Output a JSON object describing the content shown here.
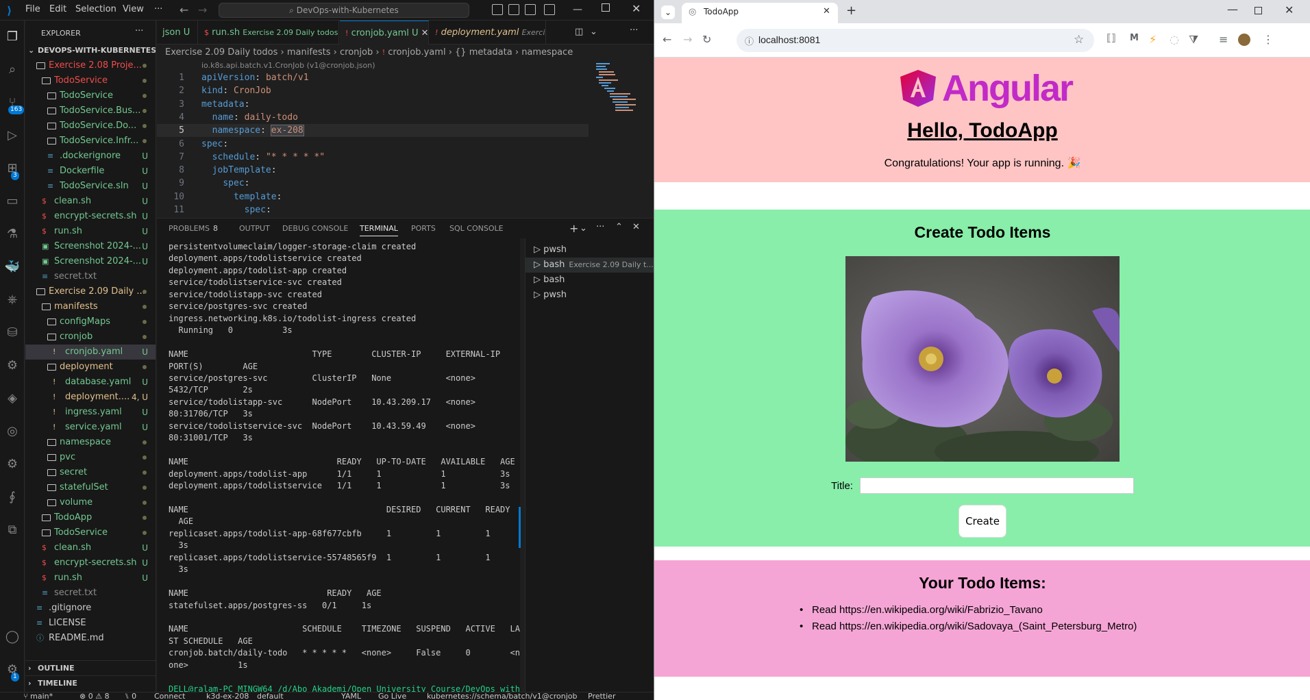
{
  "vscode": {
    "menu": [
      "File",
      "Edit",
      "Selection",
      "View",
      "···"
    ],
    "command_center": "DevOps-with-Kubernetes",
    "activity_badges": {
      "source_control": "163",
      "extensions": "3",
      "accounts": "1"
    },
    "explorer": {
      "title": "EXPLORER",
      "root": "DEVOPS-WITH-KUBERNETES",
      "tree": [
        {
          "label": "Exercise 2.08 Proje...",
          "color": "red",
          "indent": 1,
          "type": "folder",
          "badge": "dot"
        },
        {
          "label": "TodoService",
          "color": "red",
          "indent": 2,
          "type": "folder",
          "badge": "dot"
        },
        {
          "label": "TodoService",
          "color": "green",
          "indent": 3,
          "type": "folder",
          "badge": "dot"
        },
        {
          "label": "TodoService.Bus...",
          "color": "green",
          "indent": 3,
          "type": "folder",
          "badge": "dot"
        },
        {
          "label": "TodoService.Do...",
          "color": "green",
          "indent": 3,
          "type": "folder",
          "badge": "dot"
        },
        {
          "label": "TodoService.Infr...",
          "color": "green",
          "indent": 3,
          "type": "folder",
          "badge": "dot"
        },
        {
          "label": ".dockerignore",
          "color": "green",
          "indent": 3,
          "type": "file",
          "badge": "U"
        },
        {
          "label": "Dockerfile",
          "color": "green",
          "indent": 3,
          "type": "file",
          "badge": "U"
        },
        {
          "label": "TodoService.sln",
          "color": "green",
          "indent": 3,
          "type": "file",
          "badge": "U"
        },
        {
          "label": "clean.sh",
          "color": "green",
          "indent": 2,
          "type": "file",
          "badge": "U"
        },
        {
          "label": "encrypt-secrets.sh",
          "color": "green",
          "indent": 2,
          "type": "file",
          "badge": "U"
        },
        {
          "label": "run.sh",
          "color": "green",
          "indent": 2,
          "type": "file",
          "badge": "U"
        },
        {
          "label": "Screenshot 2024-...",
          "color": "green",
          "indent": 2,
          "type": "file",
          "badge": "U"
        },
        {
          "label": "Screenshot 2024-...",
          "color": "green",
          "indent": 2,
          "type": "file",
          "badge": "U"
        },
        {
          "label": "secret.txt",
          "color": "gray",
          "indent": 2,
          "type": "file",
          "badge": ""
        },
        {
          "label": "Exercise 2.09 Daily ...",
          "color": "yellow",
          "indent": 1,
          "type": "folder",
          "badge": "dot"
        },
        {
          "label": "manifests",
          "color": "yellow",
          "indent": 2,
          "type": "folder",
          "badge": "dot"
        },
        {
          "label": "configMaps",
          "color": "green",
          "indent": 3,
          "type": "folder",
          "badge": "dot"
        },
        {
          "label": "cronjob",
          "color": "green",
          "indent": 3,
          "type": "folder",
          "badge": "dot"
        },
        {
          "label": "cronjob.yaml",
          "color": "green",
          "indent": 4,
          "type": "file",
          "badge": "U"
        },
        {
          "label": "deployment",
          "color": "yellow",
          "indent": 3,
          "type": "folder",
          "badge": "dot"
        },
        {
          "label": "database.yaml",
          "color": "green",
          "indent": 4,
          "type": "file",
          "badge": "U"
        },
        {
          "label": "deployment....",
          "color": "yellow",
          "indent": 4,
          "type": "file",
          "badge": "4, U"
        },
        {
          "label": "ingress.yaml",
          "color": "green",
          "indent": 4,
          "type": "file",
          "badge": "U"
        },
        {
          "label": "service.yaml",
          "color": "green",
          "indent": 4,
          "type": "file",
          "badge": "U"
        },
        {
          "label": "namespace",
          "color": "green",
          "indent": 3,
          "type": "folder",
          "badge": "dot"
        },
        {
          "label": "pvc",
          "color": "green",
          "indent": 3,
          "type": "folder",
          "badge": "dot"
        },
        {
          "label": "secret",
          "color": "green",
          "indent": 3,
          "type": "folder",
          "badge": "dot"
        },
        {
          "label": "statefulSet",
          "color": "green",
          "indent": 3,
          "type": "folder",
          "badge": "dot"
        },
        {
          "label": "volume",
          "color": "green",
          "indent": 3,
          "type": "folder",
          "badge": "dot"
        },
        {
          "label": "TodoApp",
          "color": "green",
          "indent": 2,
          "type": "folder",
          "badge": "dot"
        },
        {
          "label": "TodoService",
          "color": "green",
          "indent": 2,
          "type": "folder",
          "badge": "dot"
        },
        {
          "label": "clean.sh",
          "color": "green",
          "indent": 2,
          "type": "file",
          "badge": "U"
        },
        {
          "label": "encrypt-secrets.sh",
          "color": "green",
          "indent": 2,
          "type": "file",
          "badge": "U"
        },
        {
          "label": "run.sh",
          "color": "green",
          "indent": 2,
          "type": "file",
          "badge": "U"
        },
        {
          "label": "secret.txt",
          "color": "gray",
          "indent": 2,
          "type": "file",
          "badge": ""
        },
        {
          "label": ".gitignore",
          "color": "white",
          "indent": 1,
          "type": "file",
          "badge": ""
        },
        {
          "label": "LICENSE",
          "color": "white",
          "indent": 1,
          "type": "file",
          "badge": ""
        },
        {
          "label": "README.md",
          "color": "white",
          "indent": 1,
          "type": "file",
          "badge": ""
        }
      ],
      "outline": "OUTLINE",
      "timeline": "TIMELINE"
    },
    "tabs": [
      {
        "label": "json",
        "badge": "U",
        "style": "normal"
      },
      {
        "label": "run.sh",
        "detail": "Exercise 2.09 Daily todos",
        "badge": "U",
        "style": "normal"
      },
      {
        "label": "cronjob.yaml",
        "badge": "U",
        "style": "active"
      },
      {
        "label": "deployment.yaml",
        "detail": "Exercise 2...",
        "badge": "",
        "style": "italic"
      }
    ],
    "breadcrumb": [
      "Exercise 2.09 Daily todos",
      "manifests",
      "cronjob",
      "cronjob.yaml",
      "{} metadata",
      "namespace"
    ],
    "schema_hint": "io.k8s.api.batch.v1.CronJob (v1@cronjob.json)",
    "code_lines": [
      {
        "num": "1",
        "key": "apiVersion",
        "val": "batch/v1",
        "indent": ""
      },
      {
        "num": "2",
        "key": "kind",
        "val": "CronJob",
        "indent": ""
      },
      {
        "num": "3",
        "key": "metadata",
        "val": "",
        "indent": ""
      },
      {
        "num": "4",
        "key": "name",
        "val": "daily-todo",
        "indent": "  "
      },
      {
        "num": "5",
        "key": "namespace",
        "val": "ex-208",
        "indent": "  "
      },
      {
        "num": "6",
        "key": "spec",
        "val": "",
        "indent": ""
      },
      {
        "num": "7",
        "key": "schedule",
        "val": "\"* * * * *\"",
        "indent": "  "
      },
      {
        "num": "8",
        "key": "jobTemplate",
        "val": "",
        "indent": "  "
      },
      {
        "num": "9",
        "key": "spec",
        "val": "",
        "indent": "    "
      },
      {
        "num": "10",
        "key": "template",
        "val": "",
        "indent": "      "
      },
      {
        "num": "11",
        "key": "spec",
        "val": "",
        "indent": "        "
      }
    ],
    "panel_tabs": [
      "PROBLEMS",
      "OUTPUT",
      "DEBUG CONSOLE",
      "TERMINAL",
      "PORTS",
      "SQL CONSOLE"
    ],
    "problems_count": "8",
    "terminal_lines": [
      "persistentvolumeclaim/logger-storage-claim created",
      "deployment.apps/todolistservice created",
      "deployment.apps/todolist-app created",
      "service/todolistservice-svc created",
      "service/todolistapp-svc created",
      "service/postgres-svc created",
      "ingress.networking.k8s.io/todolist-ingress created",
      "  Running   0          3s",
      "",
      "NAME                         TYPE        CLUSTER-IP     EXTERNAL-IP",
      "PORT(S)        AGE",
      "service/postgres-svc         ClusterIP   None           <none>",
      "5432/TCP       2s",
      "service/todolistapp-svc      NodePort    10.43.209.17   <none>",
      "80:31706/TCP   3s",
      "service/todolistservice-svc  NodePort    10.43.59.49    <none>",
      "80:31001/TCP   3s",
      "",
      "NAME                              READY   UP-TO-DATE   AVAILABLE   AGE",
      "deployment.apps/todolist-app      1/1     1            1           3s",
      "deployment.apps/todolistservice   1/1     1            1           3s",
      "",
      "NAME                                        DESIRED   CURRENT   READY",
      "  AGE",
      "replicaset.apps/todolist-app-68f677cbfb     1         1         1",
      "  3s",
      "replicaset.apps/todolistservice-55748565f9  1         1         1",
      "  3s",
      "",
      "NAME                            READY   AGE",
      "statefulset.apps/postgres-ss   0/1     1s",
      "",
      "NAME                       SCHEDULE    TIMEZONE   SUSPEND   ACTIVE   LA",
      "ST SCHEDULE   AGE",
      "cronjob.batch/daily-todo   * * * * *   <none>     False     0        <n",
      "one>          1s",
      "",
      "DELL@ralam-PC MINGW64 /d/Abo Akademi/Open University Course/DevOps with"
    ],
    "terminals": [
      {
        "name": "pwsh",
        "detail": ""
      },
      {
        "name": "bash",
        "detail": "Exercise 2.09 Daily t..."
      },
      {
        "name": "bash",
        "detail": ""
      },
      {
        "name": "pwsh",
        "detail": ""
      }
    ],
    "status": {
      "branch": "main*",
      "errors": "0",
      "warnings": "8",
      "ports": "0",
      "connect": "Connect",
      "context": "k3d-ex-208",
      "namespace": "default",
      "language": "YAML",
      "golive": "Go Live",
      "schema": "kubernetes://schema/batch/v1@cronjob",
      "prettier": "Prettier"
    }
  },
  "browser": {
    "tab_title": "TodoApp",
    "url": "localhost:8081",
    "page": {
      "logo_text": "Angular",
      "heading": "Hello, TodoApp",
      "subtitle": "Congratulations! Your app is running. 🎉",
      "create_heading": "Create Todo Items",
      "title_label": "Title:",
      "title_value": "",
      "create_button": "Create",
      "list_heading": "Your Todo Items:",
      "todos": [
        "Read https://en.wikipedia.org/wiki/Fabrizio_Tavano",
        "Read https://en.wikipedia.org/wiki/Sadovaya_(Saint_Petersburg_Metro)"
      ]
    }
  }
}
